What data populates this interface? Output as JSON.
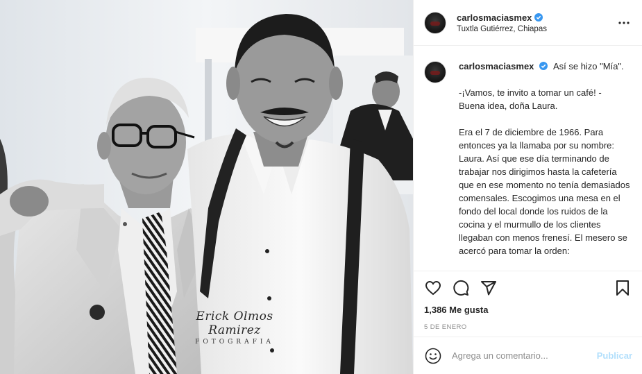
{
  "post": {
    "username": "carlosmaciasmex",
    "location": "Tuxtla Gutiérrez, Chiapas",
    "more_icon": "ellipsis-icon",
    "verified_color": "#3897f0"
  },
  "caption": {
    "first_line": "Así se hizo \"Mía\".",
    "paragraphs": [
      "-¡Vamos, te invito a tomar un café! -\nBuena idea, doña Laura.",
      "Era el 7 de diciembre de 1966. Para entonces ya la llamaba por su nombre: Laura. Así que ese día terminando de trabajar nos dirigimos hasta la cafetería que en ese momento no tenía demasiados comensales. Escogimos una mesa en el fondo del local donde los ruidos de la cocina y el murmullo de los clientes llegaban con menos frenesí. El mesero se acercó para tomar la orden:"
    ]
  },
  "photo": {
    "watermark_signature": "Erick Olmos Ramirez",
    "watermark_subtitle": "FOTOGRAFIA"
  },
  "actions": {
    "icons": [
      "heart-icon",
      "comment-icon",
      "share-icon",
      "bookmark-icon"
    ]
  },
  "likes_text": "1,386 Me gusta",
  "date_text": "5 DE ENERO",
  "comment": {
    "placeholder": "Agrega un comentario...",
    "publish_label": "Publicar",
    "emoji_icon": "smiley-icon"
  }
}
